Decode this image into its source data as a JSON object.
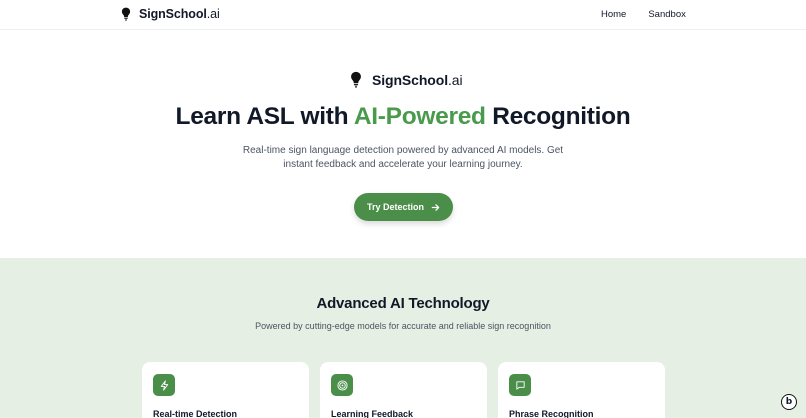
{
  "brand": {
    "name": "SignSchool",
    "suffix": ".ai"
  },
  "nav": {
    "items": [
      "Home",
      "Sandbox"
    ]
  },
  "hero": {
    "headline_pre": "Learn ASL with ",
    "headline_accent": "AI-Powered",
    "headline_post": " Recognition",
    "subtitle": "Real-time sign language detection powered by advanced AI models. Get instant feedback and accelerate your learning journey.",
    "cta_label": "Try Detection"
  },
  "features": {
    "title": "Advanced AI Technology",
    "subtitle": "Powered by cutting-edge models for accurate and reliable sign recognition",
    "cards": [
      {
        "title": "Real-time Detection",
        "icon": "lightning-icon"
      },
      {
        "title": "Learning Feedback",
        "icon": "target-icon"
      },
      {
        "title": "Phrase Recognition",
        "icon": "message-icon"
      }
    ]
  },
  "badge": {
    "label": "b"
  },
  "colors": {
    "accent": "#4a9a4e",
    "button": "#4b8e4a",
    "section_bg": "#e5efe3"
  }
}
